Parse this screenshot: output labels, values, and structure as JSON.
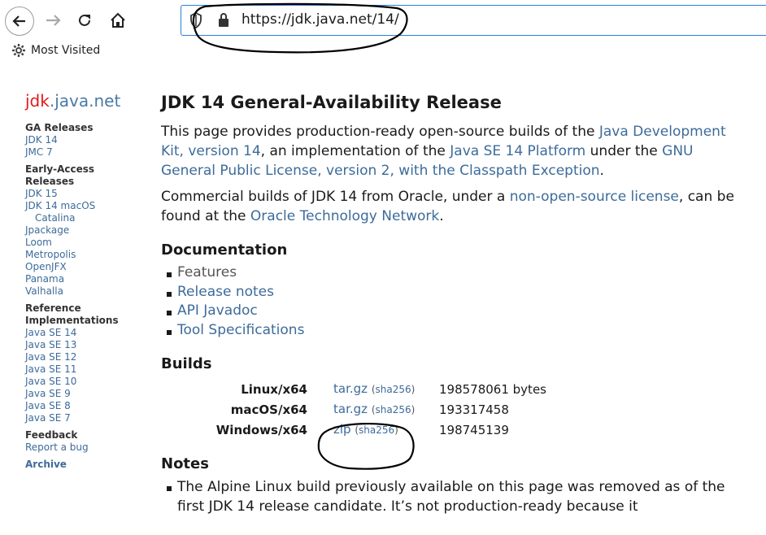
{
  "browser": {
    "url": "https://jdk.java.net/14/",
    "bookmarks_label": "Most Visited"
  },
  "sidebar": {
    "logo_jdk": "jdk",
    "logo_rest": ".java.net",
    "ga_releases": {
      "heading": "GA Releases",
      "items": [
        "JDK 14",
        "JMC 7"
      ]
    },
    "early_access": {
      "heading_line1": "Early-Access",
      "heading_line2": "Releases",
      "items": [
        "JDK 15",
        "JDK 14 macOS",
        "Catalina",
        "Jpackage",
        "Loom",
        "Metropolis",
        "OpenJFX",
        "Panama",
        "Valhalla"
      ]
    },
    "reference": {
      "heading_line1": "Reference",
      "heading_line2": "Implementations",
      "items": [
        "Java SE 14",
        "Java SE 13",
        "Java SE 12",
        "Java SE 11",
        "Java SE 10",
        "Java SE 9",
        "Java SE 8",
        "Java SE 7"
      ]
    },
    "feedback": {
      "heading": "Feedback",
      "items": [
        "Report a bug"
      ]
    },
    "archive": "Archive"
  },
  "main": {
    "title": "JDK 14 General-Availability Release",
    "intro": {
      "t1": "This page provides production-ready open-source builds of the ",
      "l1": "Java Development Kit, version 14",
      "t2": ", an implementation of the ",
      "l2": "Java SE 14 Platform",
      "t3": " under the ",
      "l3": "GNU General Public License, version 2, with the Classpath Exception",
      "t4": "."
    },
    "commercial": {
      "t1": "Commercial builds of JDK 14 from Oracle, under a ",
      "l1": "non-open-source license",
      "t2": ", can be found at the ",
      "l2": "Oracle Technology Network",
      "t3": "."
    },
    "documentation": {
      "heading": "Documentation",
      "items": [
        "Features",
        "Release notes",
        "API Javadoc",
        "Tool Specifications"
      ]
    },
    "builds": {
      "heading": "Builds",
      "sha_label": "sha256",
      "rows": [
        {
          "platform": "Linux/x64",
          "format": "tar.gz",
          "size": "198578061 bytes"
        },
        {
          "platform": "macOS/x64",
          "format": "tar.gz",
          "size": "193317458"
        },
        {
          "platform": "Windows/x64",
          "format": "zip",
          "size": "198745139"
        }
      ]
    },
    "notes": {
      "heading": "Notes",
      "item1": "The Alpine Linux build previously available on this page was removed as of the first JDK 14 release candidate. It’s not production-ready because it"
    }
  }
}
